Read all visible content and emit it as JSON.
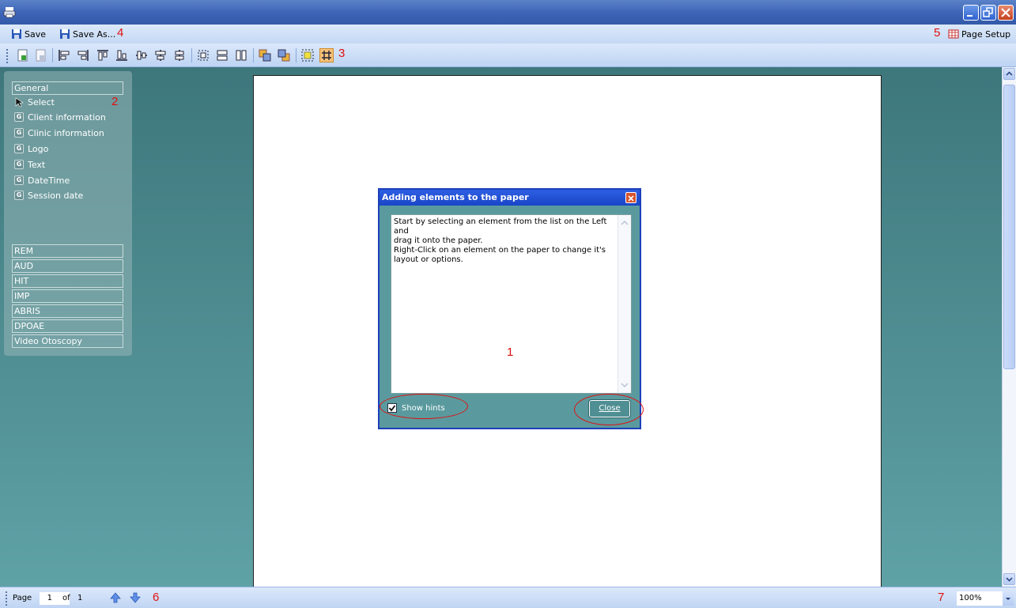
{
  "menubar": {
    "save_label": "Save",
    "save_as_label": "Save As...",
    "page_setup_label": "Page Setup",
    "marker_4": "4",
    "marker_5": "5"
  },
  "toolbar": {
    "marker_3": "3"
  },
  "sidepanel": {
    "general_header": "General",
    "marker_2": "2",
    "items": [
      {
        "label": "Select",
        "icon": "arrow-cursor-icon"
      },
      {
        "label": "Client information",
        "icon": "g-icon"
      },
      {
        "label": "Clinic information",
        "icon": "g-icon"
      },
      {
        "label": "Logo",
        "icon": "g-icon"
      },
      {
        "label": "Text",
        "icon": "g-icon"
      },
      {
        "label": "DateTime",
        "icon": "g-icon"
      },
      {
        "label": "Session date",
        "icon": "g-icon"
      }
    ],
    "g_glyph": "G",
    "categories": [
      "REM",
      "AUD",
      "HIT",
      "IMP",
      "ABRIS",
      "DPOAE",
      "Video Otoscopy"
    ]
  },
  "dialog": {
    "title": "Adding elements to the paper",
    "line1": "Start by selecting an element from the list on the Left and",
    "line2": "drag it onto the paper.",
    "line3": "Right-Click on an element on the paper to  change it's",
    "line4": "layout or options.",
    "marker_1": "1",
    "show_hints_label": "Show hints",
    "show_hints_checked": true,
    "close_label": "Close"
  },
  "statusbar": {
    "page_label": "Page",
    "page_value": "1",
    "of_label": "of",
    "total_pages": "1",
    "marker_6": "6",
    "marker_7": "7",
    "zoom_value": "100%"
  },
  "colors": {
    "annotation_red": "#e01010",
    "workspace_teal": "#4e8f93",
    "titlebar_blue": "#3c63b6"
  }
}
